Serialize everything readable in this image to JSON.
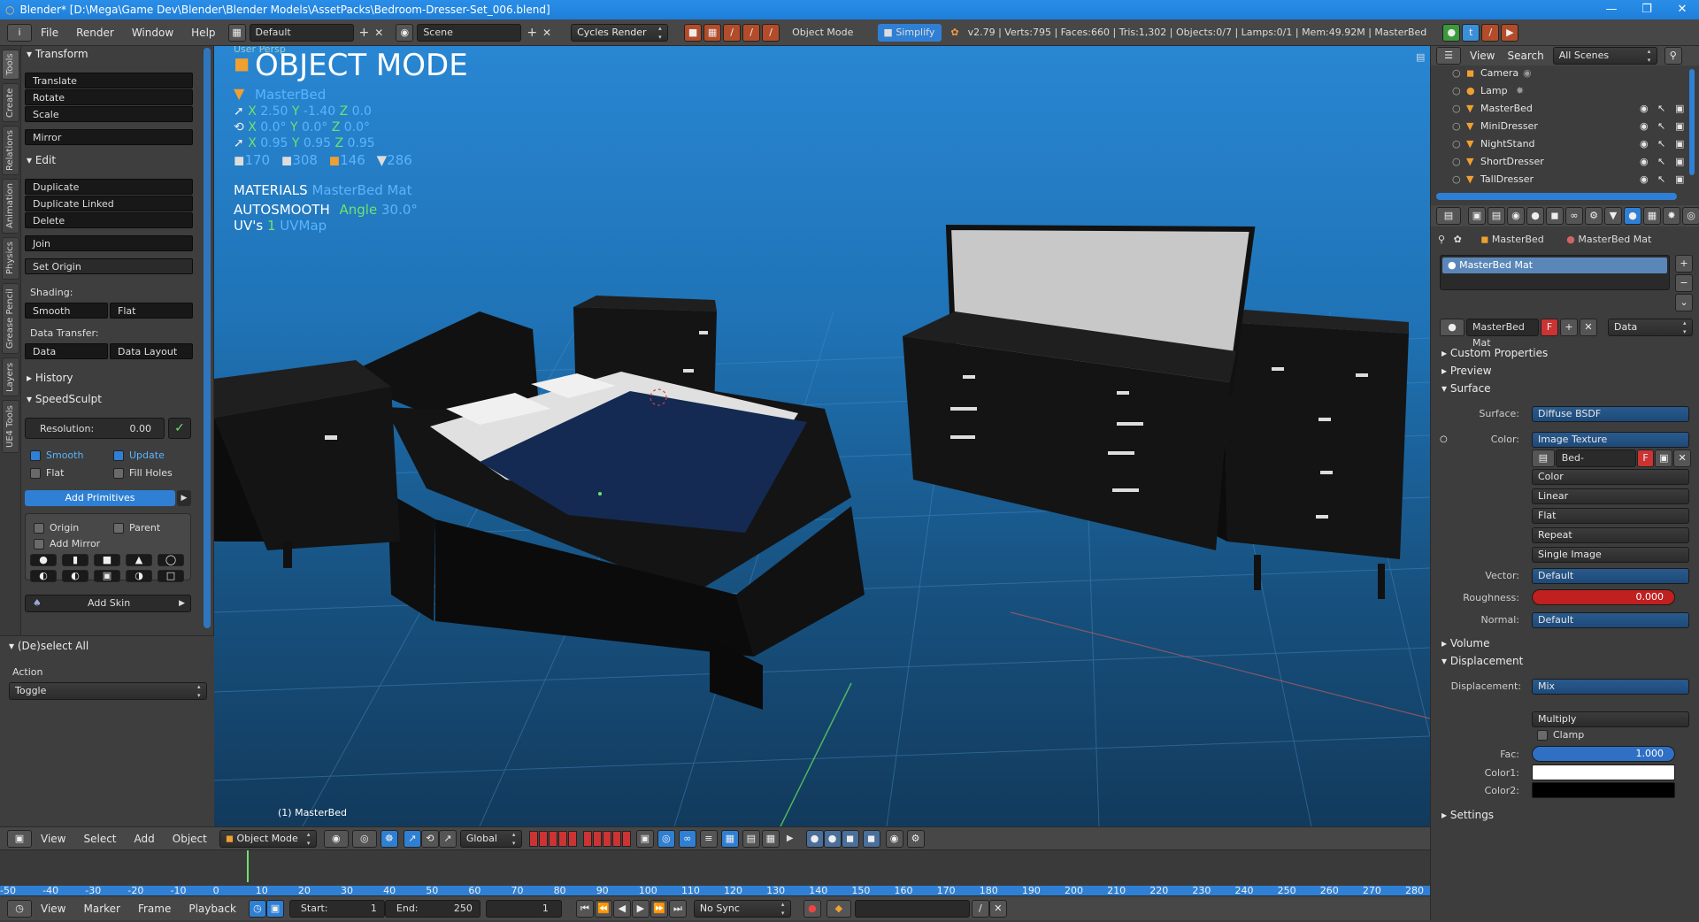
{
  "titlebar": {
    "title": "Blender* [D:\\Mega\\Game Dev\\Blender\\Blender Models\\AssetPacks\\Bedroom-Dresser-Set_006.blend]",
    "minimize": "—",
    "maximize": "❐",
    "close": "✕"
  },
  "menubar": {
    "menus": [
      "File",
      "Render",
      "Window",
      "Help"
    ],
    "layout": "Default",
    "scene": "Scene",
    "engine": "Cycles Render",
    "mode": "Object Mode",
    "simplify": "Simplify",
    "stats": "v2.79 | Verts:795 | Faces:660 | Tris:1,302 | Objects:0/7 | Lamps:0/1 | Mem:49.92M | MasterBed"
  },
  "tabs": [
    "Tools",
    "Create",
    "Relations",
    "Animation",
    "Physics",
    "Grease Pencil",
    "Layers",
    "UE4 Tools"
  ],
  "toolshelf": {
    "transform_header": "Transform",
    "translate": "Translate",
    "rotate": "Rotate",
    "scale": "Scale",
    "mirror": "Mirror",
    "edit_header": "Edit",
    "duplicate": "Duplicate",
    "duplicate_linked": "Duplicate Linked",
    "delete": "Delete",
    "join": "Join",
    "set_origin": "Set Origin",
    "shading_label": "Shading:",
    "smooth": "Smooth",
    "flat": "Flat",
    "data_transfer_label": "Data Transfer:",
    "data": "Data",
    "data_layout": "Data Layout",
    "history_header": "History",
    "speedsculpt_header": "SpeedSculpt",
    "resolution_label": "Resolution:",
    "resolution_value": "0.00",
    "smooth_chk": "Smooth",
    "update_chk": "Update",
    "flat_chk": "Flat",
    "fill_holes_chk": "Fill Holes",
    "add_primitives": "Add Primitives",
    "origin_chk": "Origin",
    "parent_chk": "Parent",
    "add_mirror_chk": "Add Mirror",
    "add_skin": "Add Skin",
    "deselect_header": "(De)select All",
    "action_label": "Action",
    "action_value": "Toggle"
  },
  "viewport": {
    "view_name": "User Persp",
    "mode_title": "OBJECT MODE",
    "object_name": "MasterBed",
    "loc": {
      "x": "2.50",
      "y": "-1.40",
      "z": "0.0"
    },
    "rot": {
      "x": "0.0°",
      "y": "0.0°",
      "z": "0.0°"
    },
    "scl": {
      "x": "0.95",
      "y": "0.95",
      "z": "0.95"
    },
    "count1": "170",
    "count2": "308",
    "count3": "146",
    "count4": "286",
    "materials_label": "MATERIALS",
    "materials_value": "MasterBed Mat",
    "autosmooth_label": "AUTOSMOOTH",
    "angle_label": "Angle",
    "angle_value": "30.0°",
    "uvs_label": "UV's",
    "uvs_count": "1",
    "uvs_value": "UVMap",
    "selected_info": "(1) MasterBed",
    "colors": {
      "accent": "#5ab4ff",
      "green": "#6fe26f"
    }
  },
  "vp_header": {
    "view": "View",
    "select": "Select",
    "add": "Add",
    "object": "Object",
    "mode": "Object Mode",
    "orientation": "Global"
  },
  "timeline": {
    "ticks": [
      "-50",
      "-40",
      "-30",
      "-20",
      "-10",
      "0",
      "10",
      "20",
      "30",
      "40",
      "50",
      "60",
      "70",
      "80",
      "90",
      "100",
      "110",
      "120",
      "130",
      "140",
      "150",
      "160",
      "170",
      "180",
      "190",
      "200",
      "210",
      "220",
      "230",
      "240",
      "250",
      "260",
      "270",
      "280"
    ],
    "current_frame": 0
  },
  "bottombar": {
    "view": "View",
    "marker": "Marker",
    "frame": "Frame",
    "playback": "Playback",
    "start_label": "Start:",
    "start_value": "1",
    "end_label": "End:",
    "end_value": "250",
    "current": "1",
    "sync": "No Sync"
  },
  "outliner": {
    "view": "View",
    "search": "Search",
    "filter": "All Scenes",
    "items": [
      "Camera",
      "Lamp",
      "MasterBed",
      "MiniDresser",
      "NightStand",
      "ShortDresser",
      "TallDresser"
    ]
  },
  "props": {
    "breadcrumb_obj": "MasterBed",
    "breadcrumb_mat": "MasterBed Mat",
    "slot": "MasterBed Mat",
    "mat_name": "MasterBed Mat",
    "fake_user": "F",
    "link": "Data",
    "custom_properties": "Custom Properties",
    "preview": "Preview",
    "surface_header": "Surface",
    "surface_label": "Surface:",
    "surface_value": "Diffuse BSDF",
    "color_label": "Color:",
    "color_value": "Image Texture",
    "image_name": "Bed-Texture_...",
    "image_opts": [
      "Color",
      "Linear",
      "Flat",
      "Repeat",
      "Single Image"
    ],
    "vector_label": "Vector:",
    "vector_value": "Default",
    "roughness_label": "Roughness:",
    "roughness_value": "0.000",
    "normal_label": "Normal:",
    "normal_value": "Default",
    "volume": "Volume",
    "displacement_header": "Displacement",
    "displacement_label": "Displacement:",
    "displacement_value": "Mix",
    "blend_value": "Multiply",
    "clamp": "Clamp",
    "fac_label": "Fac:",
    "fac_value": "1.000",
    "color1_label": "Color1:",
    "color2_label": "Color2:",
    "settings": "Settings"
  }
}
